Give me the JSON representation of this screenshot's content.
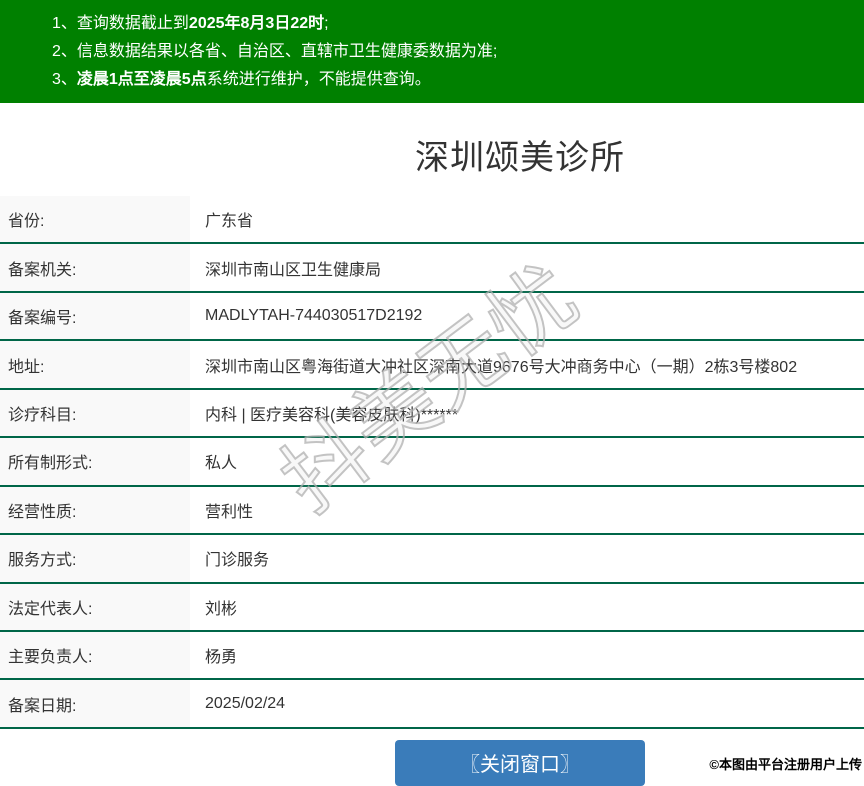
{
  "header": {
    "notices": [
      {
        "num": "1、",
        "pre": "查询数据截止到",
        "bold": "2025年8月3日22时",
        "post": ";"
      },
      {
        "num": "2、",
        "pre": "信息数据结果以各省、自治区、直辖市卫生健康委数据为准;",
        "bold": "",
        "post": ""
      },
      {
        "num": "3、",
        "pre": "",
        "bold": "凌晨1点至凌晨5点",
        "post": "系统进行维护，不能提供查询。"
      }
    ]
  },
  "title": "深圳颂美诊所",
  "table": {
    "rows": [
      {
        "label": "省份:",
        "value": "广东省"
      },
      {
        "label": "备案机关:",
        "value": "深圳市南山区卫生健康局"
      },
      {
        "label": "备案编号:",
        "value": "MADLYTAH-744030517D2192"
      },
      {
        "label": "地址:",
        "value": "深圳市南山区粤海街道大冲社区深南大道9676号大冲商务中心（一期）2栋3号楼802"
      },
      {
        "label": "诊疗科目:",
        "value": "内科 | 医疗美容科(美容皮肤科)******"
      },
      {
        "label": "所有制形式:",
        "value": "私人"
      },
      {
        "label": "经营性质:",
        "value": "营利性"
      },
      {
        "label": "服务方式:",
        "value": "门诊服务"
      },
      {
        "label": "法定代表人:",
        "value": "刘彬"
      },
      {
        "label": "主要负责人:",
        "value": "杨勇"
      },
      {
        "label": "备案日期:",
        "value": "2025/02/24"
      }
    ]
  },
  "actions": {
    "close_button": "〖关闭窗口〗"
  },
  "watermark": {
    "text": "抖美无忧"
  },
  "footer": {
    "note": "©本图由平台注册用户上传"
  },
  "colors": {
    "header_bg": "#008000",
    "row_border": "#006648",
    "label_bg": "#f9f9f9",
    "button_bg": "#3a7cba",
    "text": "#333333"
  }
}
